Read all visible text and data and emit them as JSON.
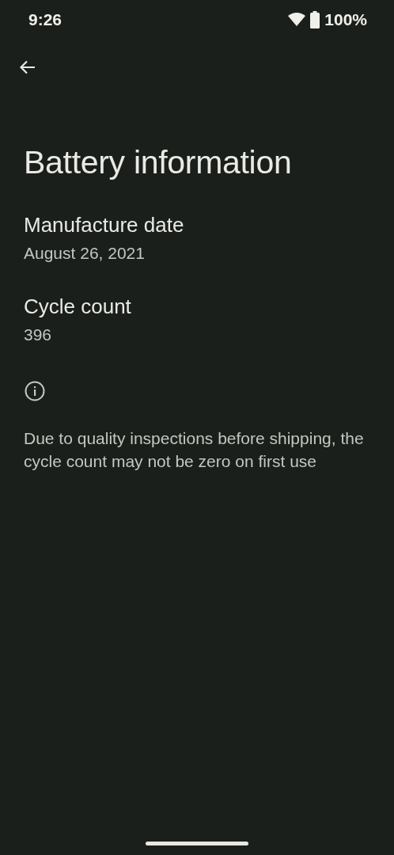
{
  "status_bar": {
    "time": "9:26",
    "battery": "100%"
  },
  "title": "Battery information",
  "items": [
    {
      "label": "Manufacture date",
      "value": "August 26, 2021"
    },
    {
      "label": "Cycle count",
      "value": "396"
    }
  ],
  "footer": {
    "text": "Due to quality inspections before shipping, the cycle count may not be zero on first use"
  }
}
